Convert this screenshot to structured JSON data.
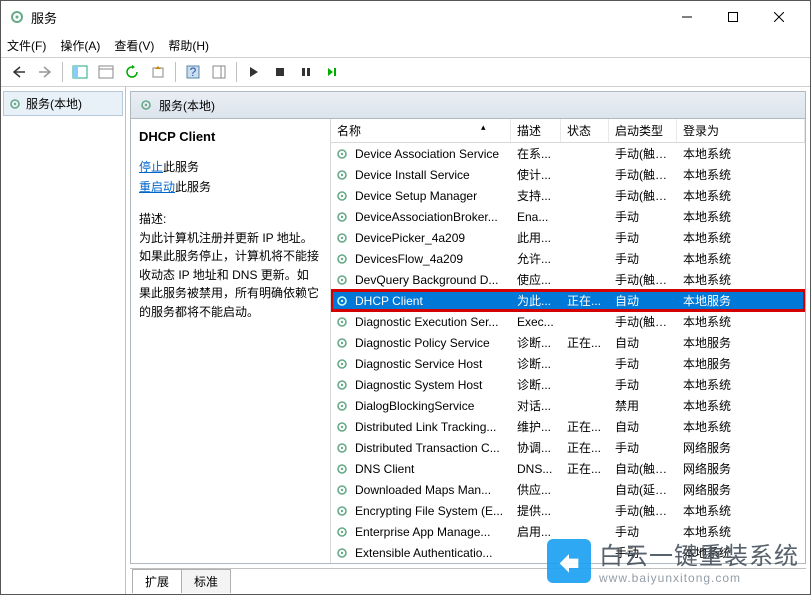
{
  "window": {
    "title": "服务"
  },
  "menu": {
    "file": "文件(F)",
    "action": "操作(A)",
    "view": "查看(V)",
    "help": "帮助(H)"
  },
  "tree": {
    "root": "服务(本地)"
  },
  "console": {
    "header": "服务(本地)"
  },
  "detail": {
    "name": "DHCP Client",
    "stop_link": "停止",
    "stop_tail": "此服务",
    "restart_link": "重启动",
    "restart_tail": "此服务",
    "desc_label": "描述:",
    "desc": "为此计算机注册并更新 IP 地址。如果此服务停止，计算机将不能接收动态 IP 地址和 DNS 更新。如果此服务被禁用，所有明确依赖它的服务都将不能启动。"
  },
  "columns": {
    "name": "名称",
    "desc": "描述",
    "status": "状态",
    "startup": "启动类型",
    "logon": "登录为"
  },
  "services": [
    {
      "name": "Device Association Service",
      "desc": "在系...",
      "status": "",
      "startup": "手动(触发...",
      "logon": "本地系统"
    },
    {
      "name": "Device Install Service",
      "desc": "使计...",
      "status": "",
      "startup": "手动(触发...",
      "logon": "本地系统"
    },
    {
      "name": "Device Setup Manager",
      "desc": "支持...",
      "status": "",
      "startup": "手动(触发...",
      "logon": "本地系统"
    },
    {
      "name": "DeviceAssociationBroker...",
      "desc": "Ena...",
      "status": "",
      "startup": "手动",
      "logon": "本地系统"
    },
    {
      "name": "DevicePicker_4a209",
      "desc": "此用...",
      "status": "",
      "startup": "手动",
      "logon": "本地系统"
    },
    {
      "name": "DevicesFlow_4a209",
      "desc": "允许...",
      "status": "",
      "startup": "手动",
      "logon": "本地系统"
    },
    {
      "name": "DevQuery Background D...",
      "desc": "使应...",
      "status": "",
      "startup": "手动(触发...",
      "logon": "本地系统"
    },
    {
      "name": "DHCP Client",
      "desc": "为此...",
      "status": "正在...",
      "startup": "自动",
      "logon": "本地服务",
      "selected": true
    },
    {
      "name": "Diagnostic Execution Ser...",
      "desc": "Exec...",
      "status": "",
      "startup": "手动(触发...",
      "logon": "本地系统"
    },
    {
      "name": "Diagnostic Policy Service",
      "desc": "诊断...",
      "status": "正在...",
      "startup": "自动",
      "logon": "本地服务"
    },
    {
      "name": "Diagnostic Service Host",
      "desc": "诊断...",
      "status": "",
      "startup": "手动",
      "logon": "本地服务"
    },
    {
      "name": "Diagnostic System Host",
      "desc": "诊断...",
      "status": "",
      "startup": "手动",
      "logon": "本地系统"
    },
    {
      "name": "DialogBlockingService",
      "desc": "对话...",
      "status": "",
      "startup": "禁用",
      "logon": "本地系统"
    },
    {
      "name": "Distributed Link Tracking...",
      "desc": "维护...",
      "status": "正在...",
      "startup": "自动",
      "logon": "本地系统"
    },
    {
      "name": "Distributed Transaction C...",
      "desc": "协调...",
      "status": "正在...",
      "startup": "手动",
      "logon": "网络服务"
    },
    {
      "name": "DNS Client",
      "desc": "DNS...",
      "status": "正在...",
      "startup": "自动(触发...",
      "logon": "网络服务"
    },
    {
      "name": "Downloaded Maps Man...",
      "desc": "供应...",
      "status": "",
      "startup": "自动(延迟...",
      "logon": "网络服务"
    },
    {
      "name": "Encrypting File System (E...",
      "desc": "提供...",
      "status": "",
      "startup": "手动(触发...",
      "logon": "本地系统"
    },
    {
      "name": "Enterprise App Manage...",
      "desc": "启用...",
      "status": "",
      "startup": "手动",
      "logon": "本地系统"
    },
    {
      "name": "Extensible Authenticatio...",
      "desc": "",
      "status": "",
      "startup": "手动",
      "logon": "本地系统"
    }
  ],
  "tabs": {
    "extended": "扩展",
    "standard": "标准"
  },
  "watermark": {
    "line1": "白云一键重装系统",
    "line2": "www.baiyunxitong.com"
  }
}
